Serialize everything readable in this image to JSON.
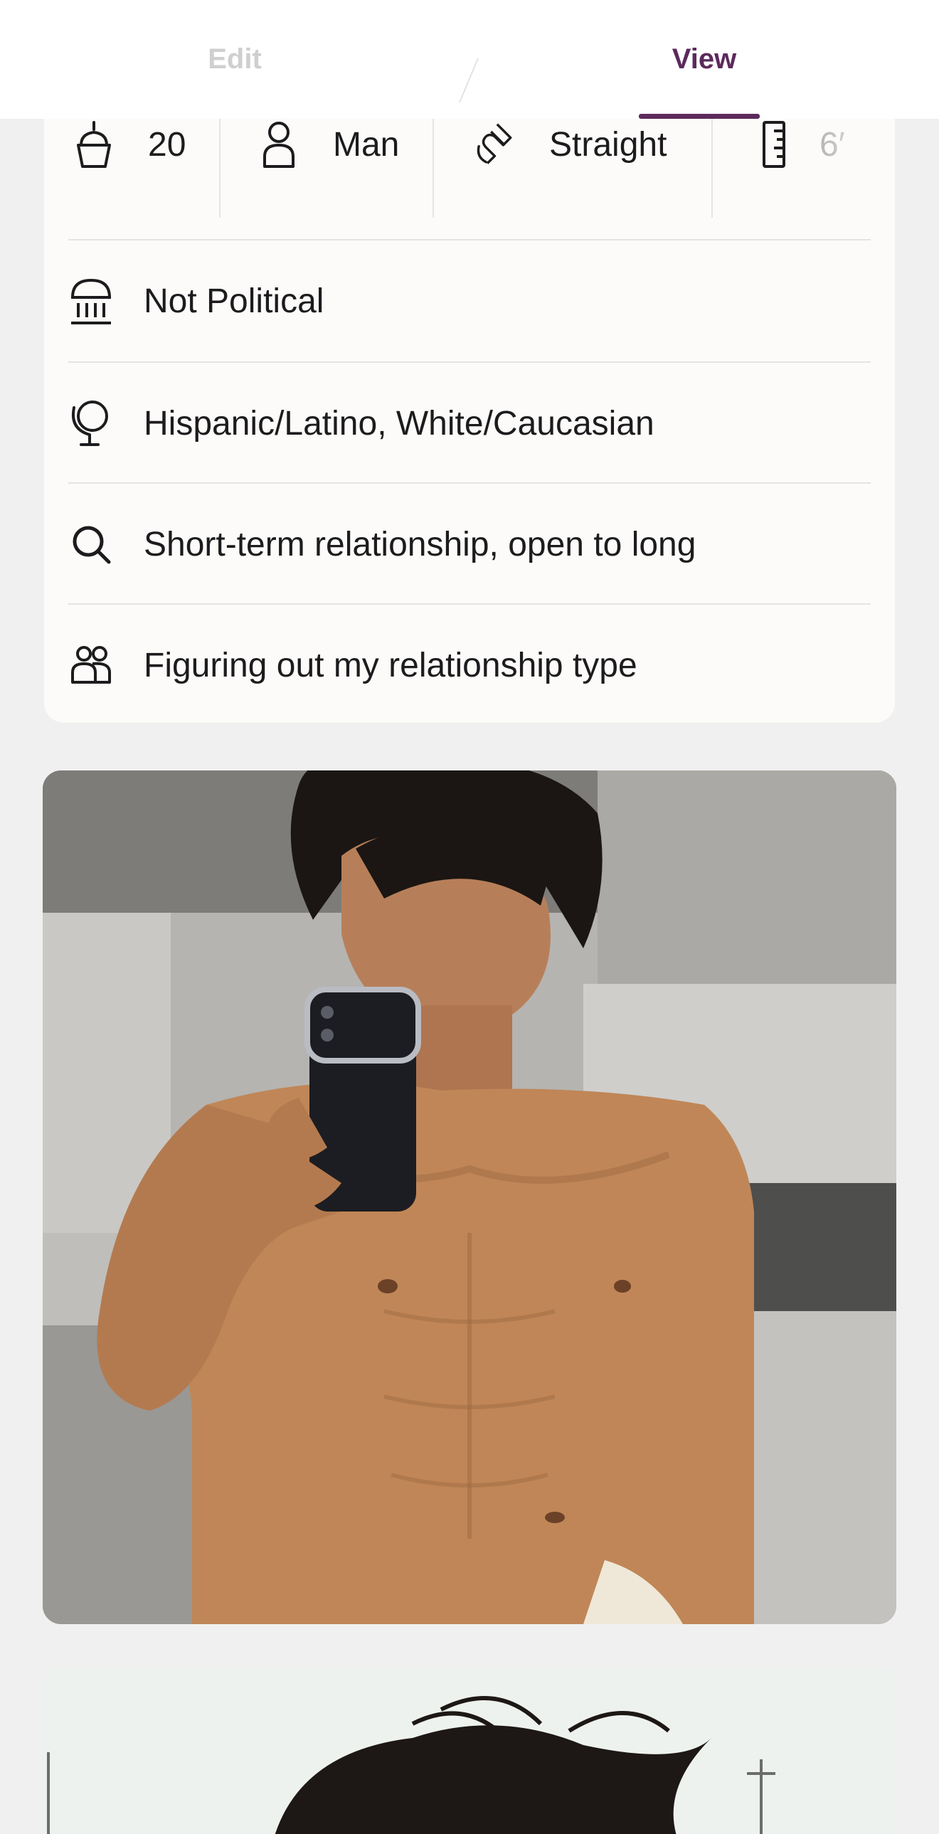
{
  "tabs": {
    "edit_label": "Edit",
    "view_label": "View",
    "active": "View"
  },
  "stats": {
    "age": "20",
    "gender": "Man",
    "sexuality": "Straight",
    "height": "6′"
  },
  "details": {
    "politics": "Not Political",
    "ethnicity": "Hispanic/Latino, White/Caucasian",
    "dating_intention": "Short-term relationship, open to long",
    "relationship_type": "Figuring out my relationship type"
  },
  "icons": {
    "age": "cupcake-icon",
    "gender": "person-icon",
    "sexuality": "magnet-icon",
    "height": "ruler-icon",
    "politics": "government-building-icon",
    "ethnicity": "globe-icon",
    "dating_intention": "search-icon",
    "relationship_type": "people-icon"
  },
  "colors": {
    "accent": "#5c2a5c",
    "card_background": "#fcfbf9",
    "page_background": "#f0f0f0"
  }
}
